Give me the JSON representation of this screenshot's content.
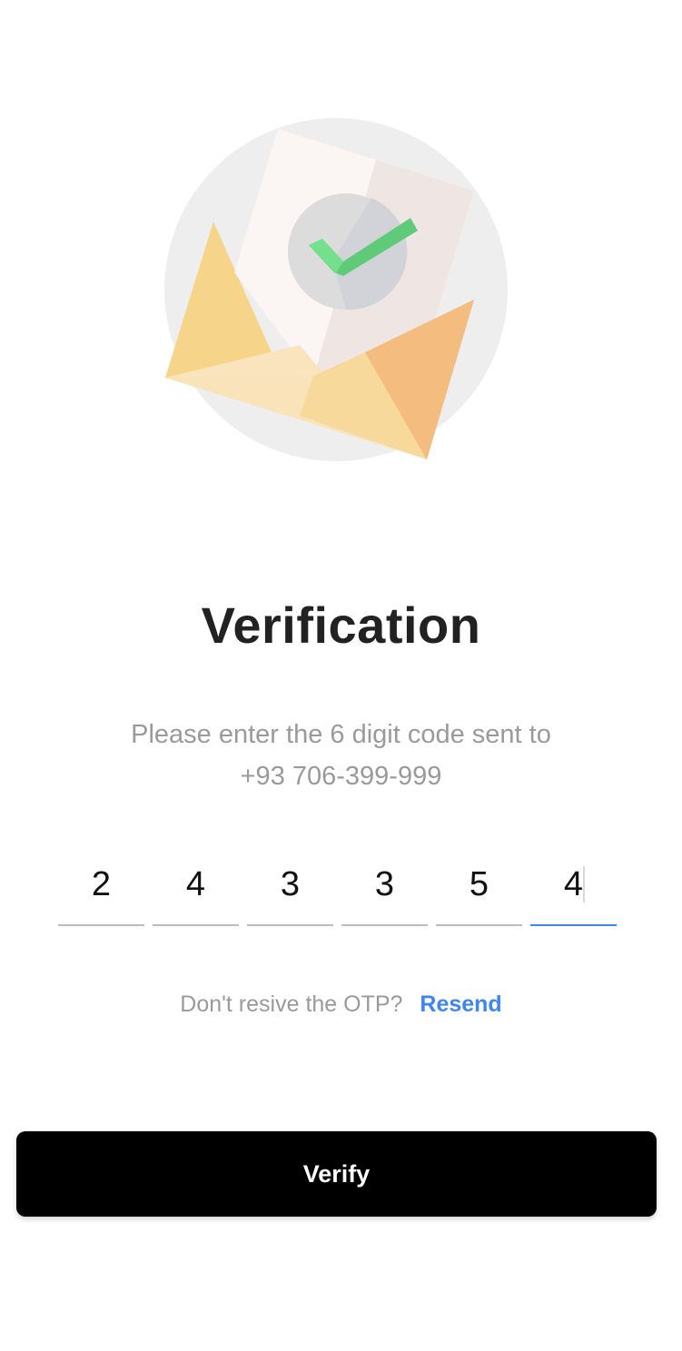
{
  "header": {
    "title": "Verification",
    "instruction_line1": "Please enter the 6 digit code sent to",
    "instruction_line2": "+93 706-399-999"
  },
  "otp": {
    "digits": [
      "2",
      "4",
      "3",
      "3",
      "5",
      "4"
    ],
    "active_index": 5
  },
  "resend": {
    "prompt": "Don't resive the OTP?",
    "link_label": "Resend"
  },
  "actions": {
    "verify_label": "Verify"
  },
  "illustration": {
    "icon": "envelope-check-icon"
  },
  "colors": {
    "accent": "#3d86f4",
    "button_bg": "#000000",
    "title": "#222222",
    "muted": "#9a9a9a"
  }
}
